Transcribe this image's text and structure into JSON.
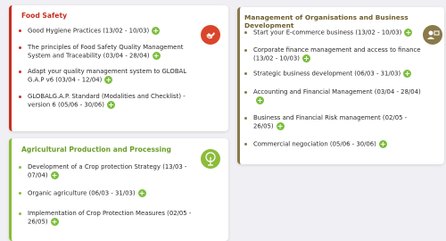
{
  "colors": {
    "food_safety": "#c4301f",
    "agriculture": "#8cbc3a",
    "management": "#8a7a4a",
    "add_button": "#7cbd3e"
  },
  "cards": {
    "food_safety": {
      "title": "Food Safety",
      "icon": "handshake-icon",
      "items": [
        {
          "label": "Good Hygiene Practices (13/02 - 10/03)"
        },
        {
          "label": "The principles of Food Safety Quality Management System and Traceability  (03/04 - 28/04)"
        },
        {
          "label": "Adapt your quality management system to GLOBAL G.A.P v6  (03/04 - 12/04)"
        },
        {
          "label": "GLOBALG.A.P. Standard (Modalities and Checklist) - version 6  (05/06 - 30/06)"
        }
      ]
    },
    "agriculture": {
      "title": "Agricultural Production and Processing",
      "icon": "sprout-icon",
      "items": [
        {
          "label": "Development of a Crop protection Strategy (13/03 - 07/04)"
        },
        {
          "label": "Organic agriculture  (06/03 - 31/03)"
        },
        {
          "label": "Implementation of Crop Protection Measures (02/05 - 26/05)"
        }
      ]
    },
    "management": {
      "title": "Management of Organisations and Business Development",
      "icon": "business-icon",
      "items": [
        {
          "label": "Start your E-commerce business (13/02 - 10/03)"
        },
        {
          "label": "Corporate finance management and access to finance (13/02 - 10/03)"
        },
        {
          "label": "Strategic business development  (06/03 - 31/03)"
        },
        {
          "label": "Accounting and Financial Management (03/04 - 28/04)"
        },
        {
          "label": "Business and Financial Risk management (02/05 - 26/05)"
        },
        {
          "label": "Commercial negociation  (05/06 - 30/06)"
        }
      ]
    }
  },
  "add_symbol": "+"
}
